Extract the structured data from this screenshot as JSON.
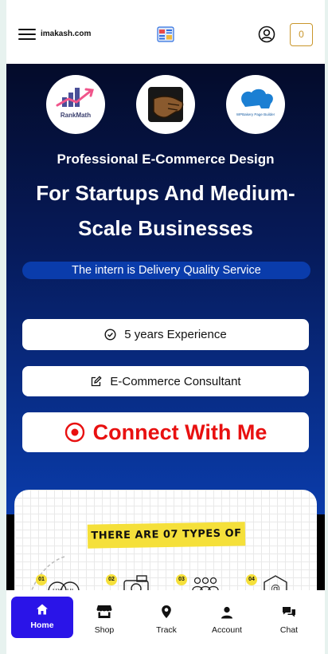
{
  "header": {
    "brand": "imakash.com",
    "cart_count": "0"
  },
  "hero": {
    "logos": [
      {
        "label": "RankMath"
      },
      {
        "label": ""
      },
      {
        "label": "WPBakery Page Builder"
      }
    ],
    "subtitle": "Professional E-Commerce Design",
    "title": "For Startups And Medium-Scale Businesses",
    "tagline": "The intern is Delivery Quality Service",
    "experience_label": "5 years Experience",
    "role_label": "E-Commerce Consultant",
    "cta_label": "Connect With Me"
  },
  "types_card": {
    "banner": "THERE ARE 07 TYPES OF",
    "steps": [
      "01",
      "02",
      "03",
      "04"
    ]
  },
  "bottom_nav": {
    "items": [
      {
        "label": "Home",
        "icon": "home-icon"
      },
      {
        "label": "Shop",
        "icon": "shop-icon"
      },
      {
        "label": "Track",
        "icon": "location-pin-icon"
      },
      {
        "label": "Account",
        "icon": "user-icon"
      },
      {
        "label": "Chat",
        "icon": "chat-icon"
      }
    ]
  },
  "colors": {
    "accent": "#2a14e8",
    "cta_text": "#e81010",
    "cart": "#c9962b",
    "hero_dark": "#040b2a",
    "hero_blue": "#0a3cab",
    "banner_yellow": "#f5e03a"
  }
}
